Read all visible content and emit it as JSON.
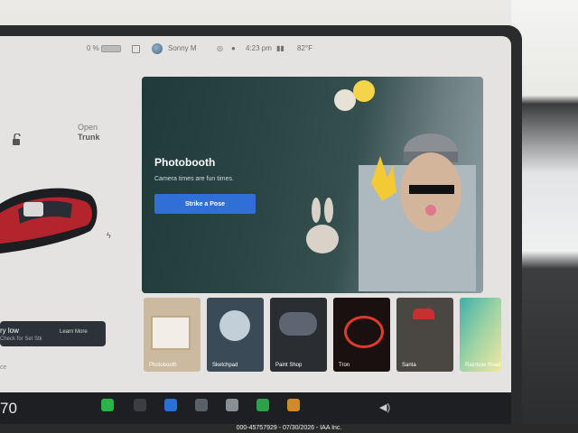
{
  "status_bar": {
    "battery_percent": "0 %",
    "profile_name": "Sonny M",
    "time": "4:23 pm",
    "temperature": "82°F"
  },
  "left_panel": {
    "trunk_label_open": "Open",
    "trunk_label_trunk": "Trunk",
    "alert_title": "ry low",
    "alert_subtitle": "Check for Set Stk",
    "alert_button": "Learn More",
    "section_label": "ce"
  },
  "photobooth": {
    "title": "Photobooth",
    "subtitle": "Camera times are fun times.",
    "button": "Strike a Pose"
  },
  "apps": [
    {
      "label": "Photobooth",
      "color": "#cbb9a0"
    },
    {
      "label": "Sketchpad",
      "color": "#3a4a57"
    },
    {
      "label": "Paint Shop",
      "color": "#2a2e33"
    },
    {
      "label": "Tron",
      "color": "#1a1010"
    },
    {
      "label": "Santa",
      "color": "#4a4642"
    },
    {
      "label": "Rainbow Road",
      "color": "#3fb0a8"
    }
  ],
  "dock": {
    "temperature": "70"
  },
  "footer": {
    "watermark": "000-45757929 - 07/30/2026 - IAA Inc."
  }
}
